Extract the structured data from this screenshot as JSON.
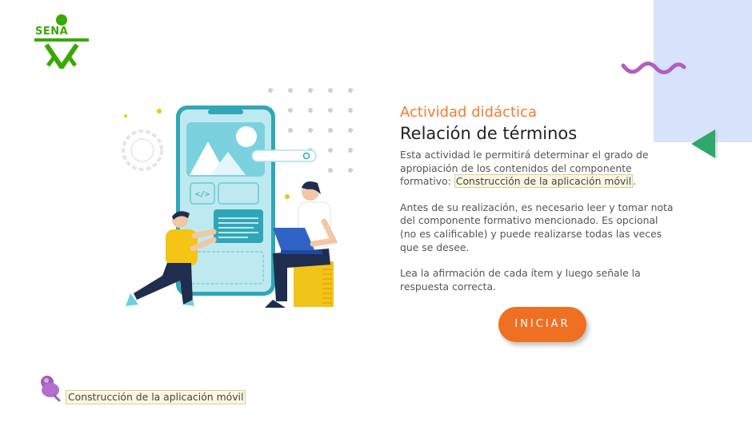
{
  "logo": {
    "text": "SENA",
    "color": "#39a900"
  },
  "activity": {
    "subtitle": "Actividad didáctica",
    "title": "Relación de términos",
    "p1_before": "Esta actividad le permitirá determinar el grado de apropiación de los contenidos del componente formativo: ",
    "p1_link": "Construcción de la aplicación móvil",
    "p1_after": ".",
    "p2": "Antes de su realización, es necesario leer y tomar nota del componente formativo mencionado.  Es opcional (no es calificable) y puede realizarse todas las veces que se desee.",
    "p3": "Lea la afirmación de cada ítem y luego señale la respuesta correcta."
  },
  "start_button": {
    "label": "INICIAR"
  },
  "footer": {
    "label": "Construcción de la aplicación móvil"
  },
  "colors": {
    "accent": "#ef7d31",
    "button": "#ef7022",
    "panel": "#d7e2fb",
    "wave": "#b05fc0",
    "triangle": "#2fa86a"
  },
  "icons": [
    "sena-logo",
    "wave-decoration",
    "triangle-left-icon",
    "thumbtack-icon"
  ]
}
